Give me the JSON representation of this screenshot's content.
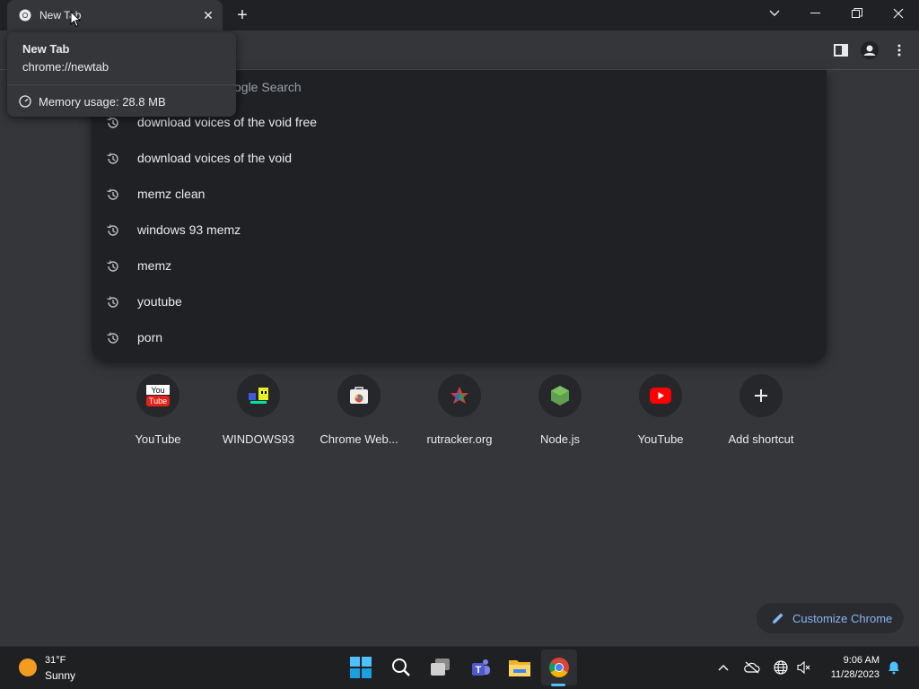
{
  "tab": {
    "title": "New Tab"
  },
  "hover_card": {
    "title": "New Tab",
    "url": "chrome://newtab",
    "memory": "Memory usage: 28.8 MB"
  },
  "omnibox": {
    "placeholder_partial": "ogle Search"
  },
  "suggestions": [
    "download voices of the void free",
    "download voices of the void",
    "memz clean",
    "windows 93 memz",
    "memz",
    "youtube",
    "porn"
  ],
  "shortcuts": [
    {
      "label": "YouTube",
      "icon": "youtube-old-logo-icon"
    },
    {
      "label": "WINDOWS93",
      "icon": "windows93-icon"
    },
    {
      "label": "Chrome Web...",
      "icon": "chrome-web-store-icon"
    },
    {
      "label": "rutracker.org",
      "icon": "rutracker-icon"
    },
    {
      "label": "Node.js",
      "icon": "nodejs-icon"
    },
    {
      "label": "YouTube",
      "icon": "youtube-icon"
    },
    {
      "label": "Add shortcut",
      "icon": "plus-icon"
    }
  ],
  "customize": {
    "label": "Customize Chrome"
  },
  "taskbar": {
    "weather_temp": "31°F",
    "weather_desc": "Sunny",
    "time": "9:06 AM",
    "date": "11/28/2023"
  },
  "colors": {
    "accent": "#8ab4f8",
    "background": "#35363a",
    "dropdown": "#202124"
  }
}
